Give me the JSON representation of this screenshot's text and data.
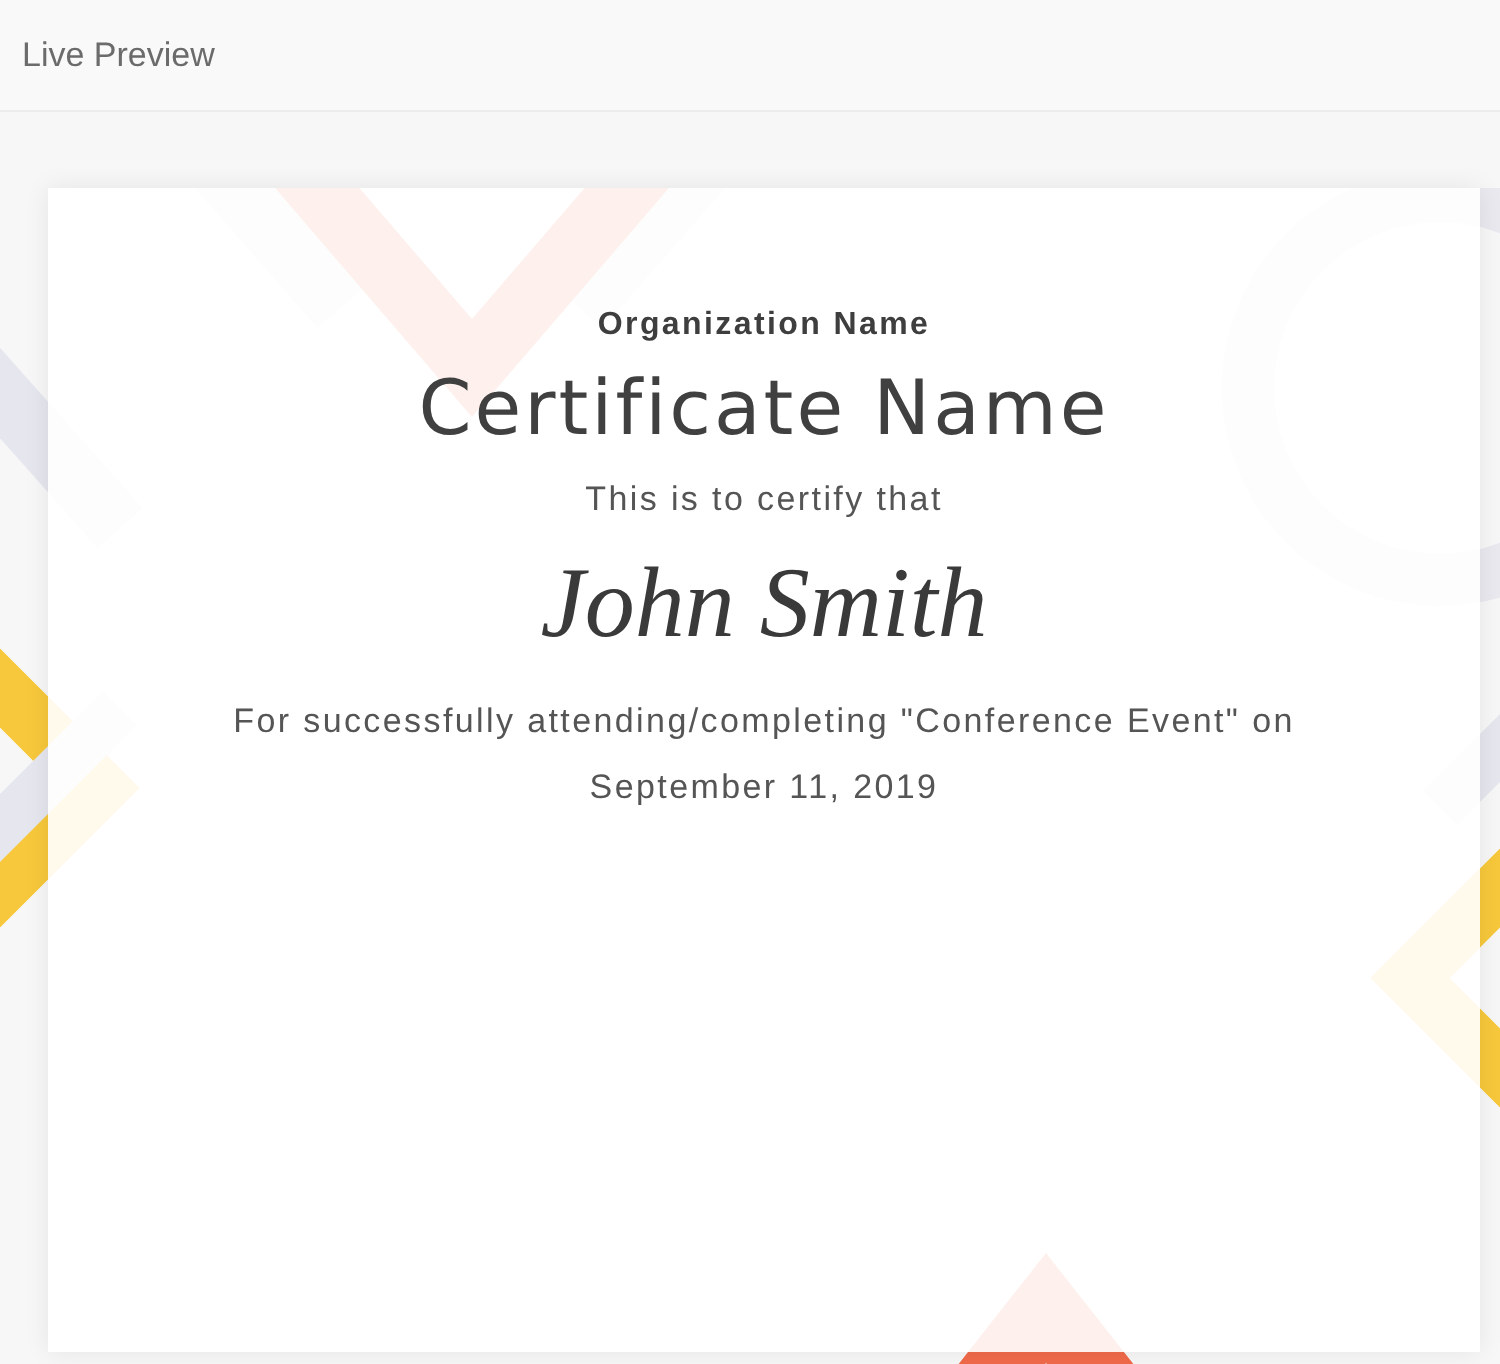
{
  "header": {
    "title": "Live Preview"
  },
  "certificate": {
    "organization": "Organization Name",
    "title": "Certificate Name",
    "intro": "This is to certify that",
    "recipient": "John Smith",
    "description": "For successfully attending/completing \"Conference Event\" on September 11, 2019"
  }
}
